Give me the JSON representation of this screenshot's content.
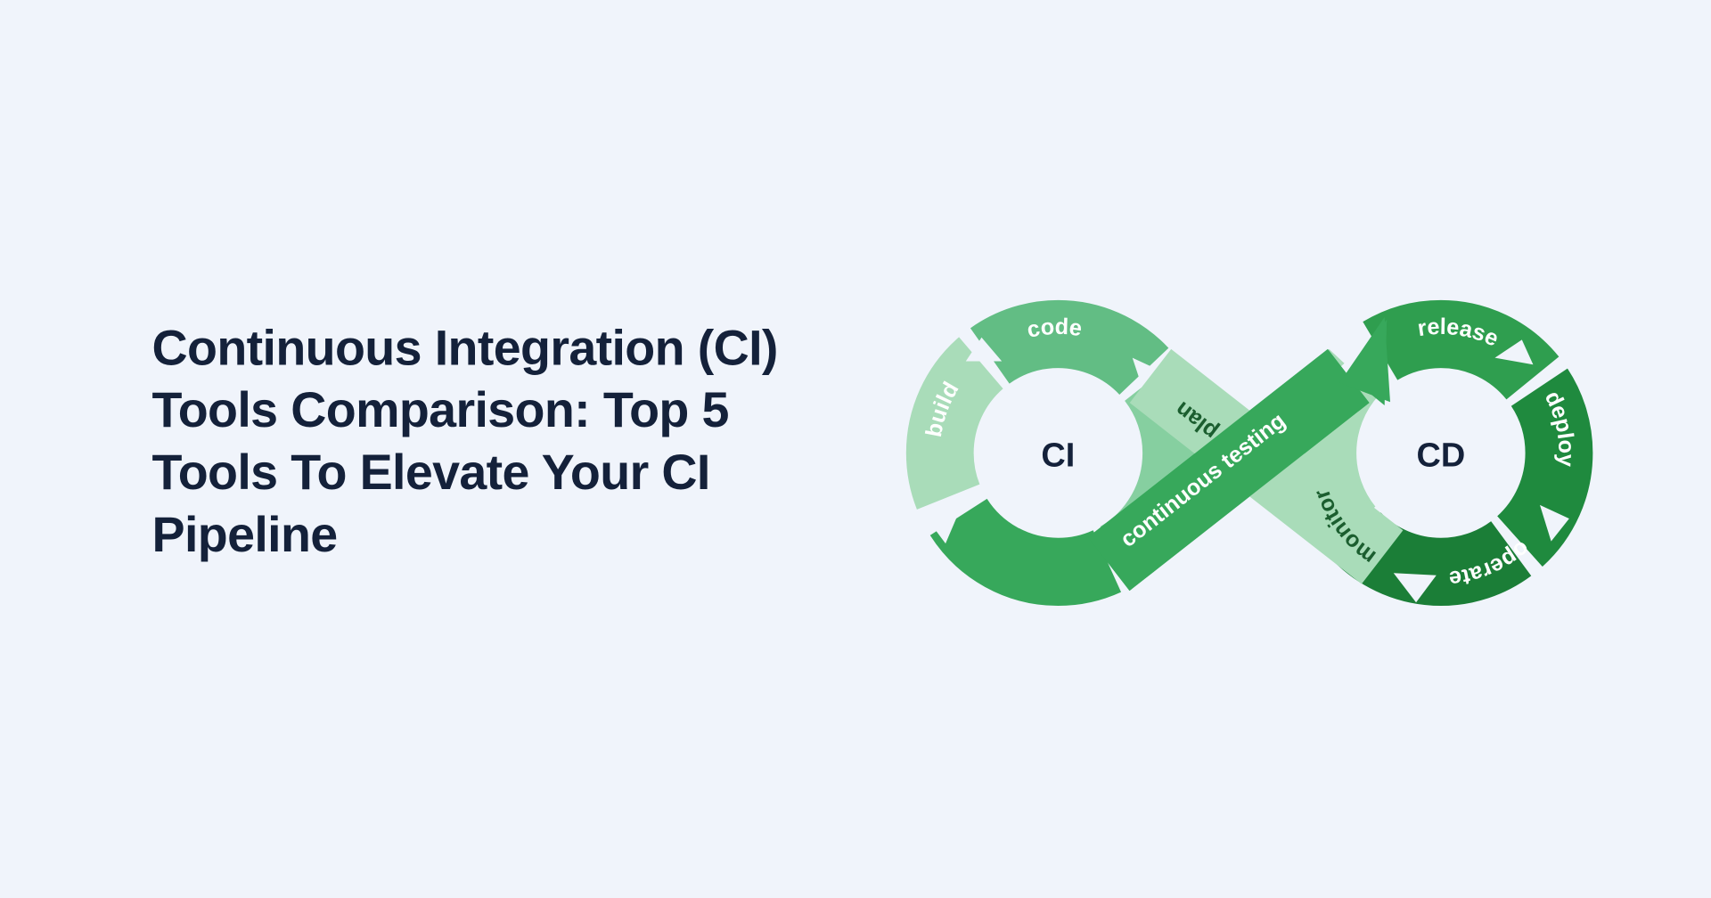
{
  "headline": "Continuous Integration (CI) Tools Comparison: Top 5 Tools To Elevate Your CI Pipeline",
  "loops": {
    "left": {
      "center": "CI"
    },
    "right": {
      "center": "CD"
    }
  },
  "segments": {
    "code": {
      "label": "code"
    },
    "build": {
      "label": "build"
    },
    "test": {
      "label": "continuous testing"
    },
    "plan": {
      "label": "plan"
    },
    "release": {
      "label": "release"
    },
    "deploy": {
      "label": "deploy"
    },
    "operate": {
      "label": "operate"
    },
    "monitor": {
      "label": "monitor"
    }
  },
  "colors": {
    "ci_light": "#86cfa0",
    "ci_mid": "#62bd84",
    "ci_dark": "#37a85b",
    "cd_light": "#a9dcb9",
    "cd_mid": "#2f9e4f",
    "cd_dark": "#1f8a3e",
    "cd_darker": "#1b7e37",
    "text_dark": "#14213a",
    "bg": "#f0f4fb"
  }
}
